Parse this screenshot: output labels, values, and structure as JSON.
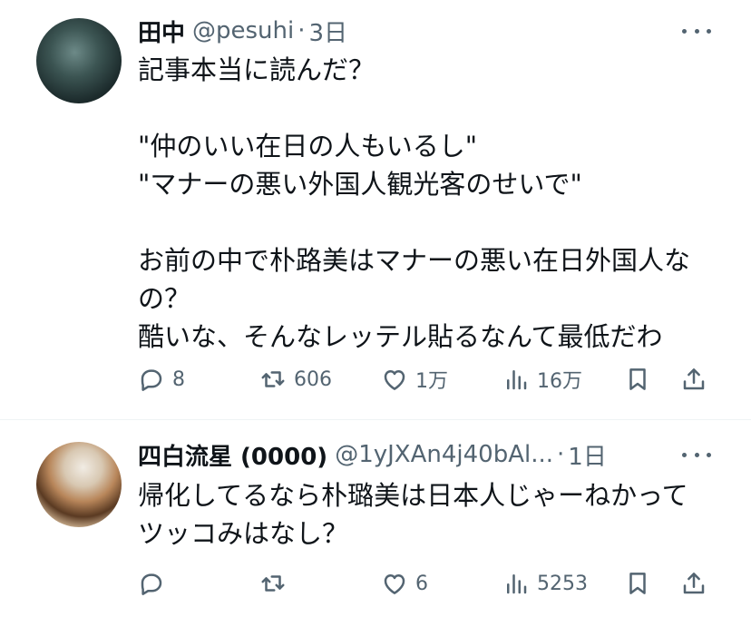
{
  "tweets": [
    {
      "name": "田中",
      "handle": "@pesuhi",
      "time": "3日",
      "body_lines": [
        "記事本当に読んだ？",
        "",
        "\"仲のいい在日の人もいるし\"",
        "\"マナーの悪い外国人観光客のせいで\"",
        "",
        "お前の中で朴路美はマナーの悪い在日外国人な",
        "の？",
        "酷いな、そんなレッテル貼るなんて最低だわ"
      ],
      "replies": "8",
      "retweets": "606",
      "likes": "1万",
      "views": "16万"
    },
    {
      "name": "四白流星 (0000)",
      "handle": "@1yJXAn4j40bAl...",
      "time": "1日",
      "body_lines": [
        "帰化してるなら朴璐美は日本人じゃーねかって",
        "ツッコみはなし？"
      ],
      "replies": "",
      "retweets": "",
      "likes": "6",
      "views": "5253"
    }
  ],
  "dot_separator": "·",
  "colors": {
    "text": "#0f1419",
    "secondary": "#536471",
    "divider": "#eff3f4"
  },
  "icons": [
    "more-icon",
    "reply-icon",
    "retweet-icon",
    "like-icon",
    "views-icon",
    "bookmark-icon",
    "share-icon"
  ]
}
